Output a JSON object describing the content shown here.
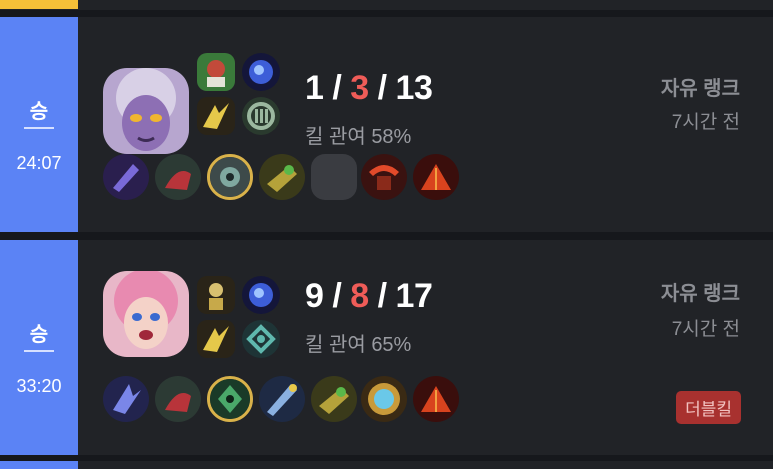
{
  "matches": [
    {
      "result": "승",
      "duration": "24:07",
      "kda": {
        "kills": "1",
        "deaths": "3",
        "assists": "13"
      },
      "kill_participation": "킬 관여 58%",
      "queue_type": "자유 랭크",
      "time_ago": "7시간 전",
      "champion_icon": "champion-portrait-purple",
      "spells": [
        "summoner-spell-icon",
        "summoner-spell-icon"
      ],
      "runes": [
        "rune-icon",
        "rune-icon"
      ],
      "items": [
        "item-icon",
        "item-icon",
        "ward-icon",
        "item-icon",
        "empty-slot",
        "item-icon",
        "item-icon"
      ]
    },
    {
      "result": "승",
      "duration": "33:20",
      "kda": {
        "kills": "9",
        "deaths": "8",
        "assists": "17"
      },
      "kill_participation": "킬 관여 65%",
      "queue_type": "자유 랭크",
      "time_ago": "7시간 전",
      "badge": "더블킬",
      "champion_icon": "champion-portrait-pink",
      "spells": [
        "summoner-spell-icon",
        "summoner-spell-icon"
      ],
      "runes": [
        "rune-icon",
        "rune-icon"
      ],
      "items": [
        "item-icon",
        "item-icon",
        "ward-icon",
        "item-icon",
        "item-icon",
        "item-icon",
        "item-icon"
      ]
    }
  ],
  "colors": {
    "win": "#5b83f5",
    "death": "#ef5c58",
    "badge_bg": "#a8312f",
    "ward_border": "#d9b24a"
  }
}
